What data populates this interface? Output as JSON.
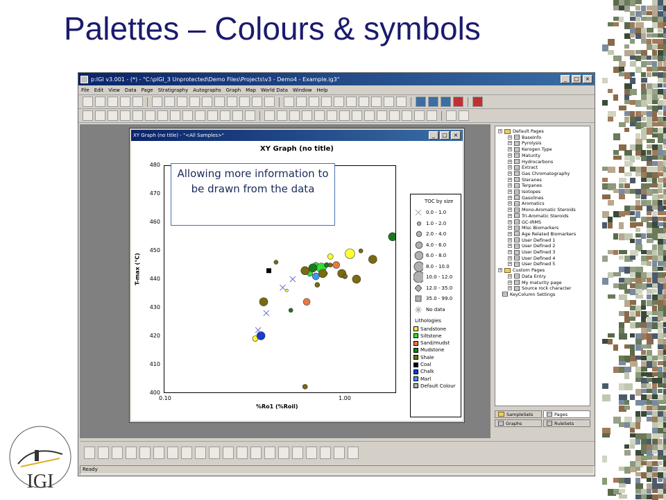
{
  "slide": {
    "title": "Palettes – Colours & symbols"
  },
  "app": {
    "title": "p:IGI v3.001 - (*) - \"C:\\pIGI_3 Unprotected\\Demo Files\\Projects\\v3 - Demo4 - Example.ig3\"",
    "menu": [
      "File",
      "Edit",
      "View",
      "Data",
      "Page",
      "Stratigraphy",
      "Autographs",
      "Graph",
      "Map",
      "World Data",
      "Window",
      "Help"
    ],
    "status": "Ready"
  },
  "child": {
    "title": "XY Graph (no title) - \"<All Samples>\"",
    "graph_title": "XY Graph (no title)",
    "callout": "Allowing more information to be drawn from the data"
  },
  "legend": {
    "size_title": "TOC by size",
    "size_items": [
      "0.0 - 1.0",
      "1.0 - 2.0",
      "2.0 - 4.0",
      "4.0 - 6.0",
      "6.0 - 8.0",
      "8.0 - 10.0",
      "10.0 - 12.0",
      "12.0 - 35.0",
      "35.0 - 99.0",
      "No data"
    ],
    "litho_title": "Lithologies",
    "litho_items": [
      {
        "label": "Sandstone",
        "color": "#ffff33"
      },
      {
        "label": "Siltstone",
        "color": "#33dd33"
      },
      {
        "label": "Sand/mudst",
        "color": "#e87840"
      },
      {
        "label": "Mudstone",
        "color": "#1a7a1a"
      },
      {
        "label": "Shale",
        "color": "#7a6a10"
      },
      {
        "label": "Coal",
        "color": "#000000"
      },
      {
        "label": "Chalk",
        "color": "#1a3ad0"
      },
      {
        "label": "Marl",
        "color": "#3a9af0"
      },
      {
        "label": "Default Colour",
        "color": "#b0b0b0"
      }
    ]
  },
  "tree": {
    "default_pages": "Default Pages",
    "pages": [
      "BaseInfo",
      "Pyrolysis",
      "Kerogen Type",
      "Maturity",
      "Hydrocarbons",
      "Extract",
      "Gas Chromatography",
      "Steranes",
      "Terpanes",
      "Isotopes",
      "Gasolines",
      "Aromatics",
      "Mono-Aromatic Steroids",
      "Tri-Aromatic Steroids",
      "GC-IRMS",
      "Misc Biomarkers",
      "Age Related Biomarkers",
      "User Defined 1",
      "User Defined 2",
      "User Defined 3",
      "User Defined 4",
      "User Defined 5"
    ],
    "custom_pages": "Custom Pages",
    "custom": [
      "Data Entry",
      "My maturity page",
      "Source rock character"
    ],
    "keycolumn": "KeyColumn Settings"
  },
  "tabs": [
    "SampleSets",
    "Pages",
    "Graphs",
    "RuleSets"
  ],
  "chart_data": {
    "type": "scatter",
    "title": "XY Graph (no title)",
    "xlabel": "%Ro1 (%Roil)",
    "ylabel": "T-max (°C)",
    "xscale": "log",
    "xlim": [
      0.1,
      1.5
    ],
    "ylim": [
      400,
      480
    ],
    "x_ticks": [
      "0.10",
      "1.00"
    ],
    "y_ticks": [
      400,
      410,
      420,
      430,
      440,
      450,
      460,
      470,
      480
    ],
    "series": [
      {
        "name": "Sandstone",
        "color": "#ffff33",
        "points": [
          [
            0.29,
            419
          ],
          [
            0.42,
            436
          ],
          [
            0.7,
            448
          ],
          [
            0.88,
            449
          ]
        ]
      },
      {
        "name": "Siltstone",
        "color": "#33dd33",
        "points": [
          [
            0.55,
            442
          ],
          [
            0.57,
            443
          ],
          [
            0.59,
            445
          ],
          [
            0.63,
            444
          ]
        ]
      },
      {
        "name": "Sand/mudst",
        "color": "#e87840",
        "points": [
          [
            0.53,
            432
          ],
          [
            0.66,
            442
          ],
          [
            0.75,
            445
          ]
        ]
      },
      {
        "name": "Mudstone",
        "color": "#1a7a1a",
        "points": [
          [
            0.44,
            429
          ],
          [
            0.57,
            444
          ],
          [
            0.67,
            445
          ],
          [
            1.45,
            455
          ]
        ]
      },
      {
        "name": "Shale",
        "color": "#7a6a10",
        "points": [
          [
            0.32,
            432
          ],
          [
            0.37,
            446
          ],
          [
            0.52,
            443
          ],
          [
            0.6,
            438
          ],
          [
            0.64,
            442
          ],
          [
            0.7,
            445
          ],
          [
            0.8,
            442
          ],
          [
            0.83,
            441
          ],
          [
            0.95,
            440
          ],
          [
            1.0,
            450
          ],
          [
            1.15,
            447
          ],
          [
            0.52,
            402
          ]
        ]
      },
      {
        "name": "Coal",
        "color": "#000000",
        "points": [
          [
            0.34,
            443
          ]
        ]
      },
      {
        "name": "Chalk",
        "color": "#1a3ad0",
        "points": [
          [
            0.31,
            420
          ]
        ]
      },
      {
        "name": "Marl",
        "color": "#3a9af0",
        "points": [
          [
            0.59,
            441
          ]
        ]
      },
      {
        "name": "No data",
        "color": "#6a6ad8",
        "points": [
          [
            0.3,
            422
          ],
          [
            0.33,
            428
          ],
          [
            0.4,
            437
          ],
          [
            0.45,
            440
          ]
        ]
      }
    ]
  }
}
